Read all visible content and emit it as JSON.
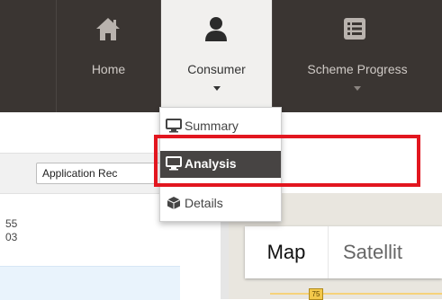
{
  "nav": {
    "items": [
      {
        "label": "Home",
        "icon": "home-icon"
      },
      {
        "label": "Consumer",
        "icon": "user-icon"
      },
      {
        "label": "Scheme Progress",
        "icon": "list-icon"
      }
    ]
  },
  "dropdown": {
    "items": [
      {
        "label": "Summary",
        "icon": "monitor-icon"
      },
      {
        "label": "Analysis",
        "icon": "monitor-icon"
      },
      {
        "label": "Details",
        "icon": "cube-icon"
      }
    ]
  },
  "left_panel": {
    "button_label": "Application Rec",
    "lines": [
      "55",
      "03"
    ]
  },
  "map": {
    "tabs": [
      "Map",
      "Satellit"
    ],
    "road_number": "75"
  },
  "colors": {
    "nav_bg": "#3a3532",
    "active_nav_bg": "#f1f0ee",
    "highlight": "#e2161f",
    "menu_active_bg": "#474443"
  }
}
